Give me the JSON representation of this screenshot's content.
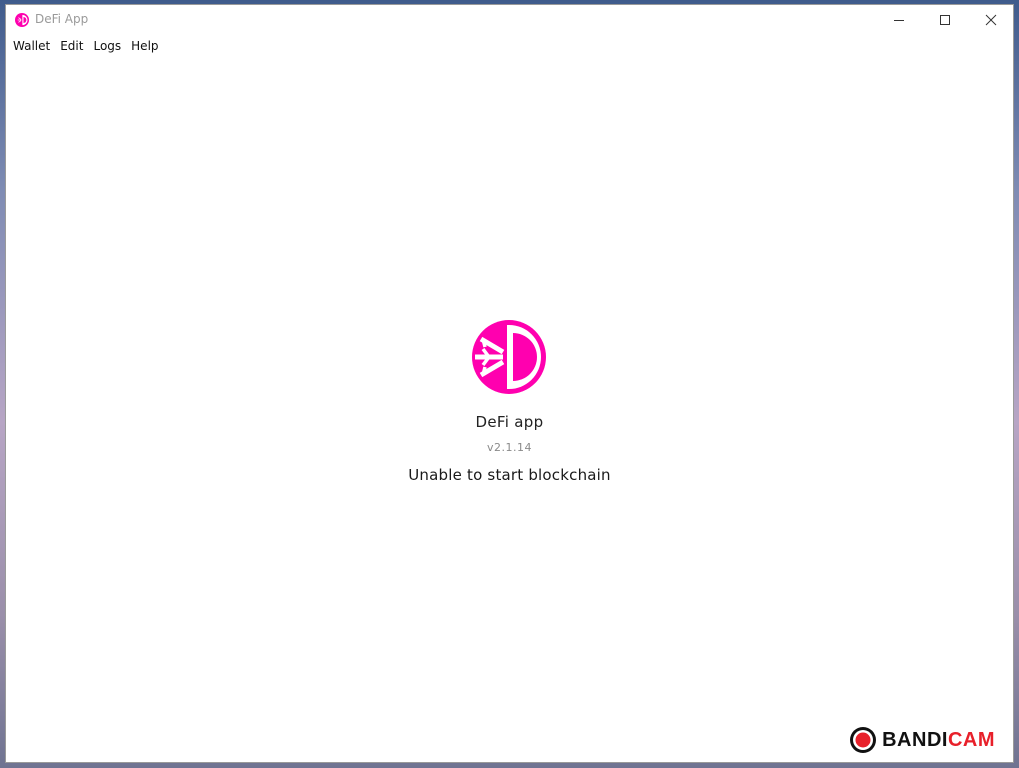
{
  "window": {
    "title": "DeFi App"
  },
  "menu": {
    "items": [
      {
        "label": "Wallet"
      },
      {
        "label": "Edit"
      },
      {
        "label": "Logs"
      },
      {
        "label": "Help"
      }
    ]
  },
  "main": {
    "app_name": "DeFi app",
    "version": "v2.1.14",
    "status": "Unable to start blockchain"
  },
  "watermark": {
    "text_part1": "BANDI",
    "text_part2": "CAM"
  },
  "colors": {
    "brand": "#ff00af",
    "watermark_red": "#e8202a"
  },
  "icons": {
    "app": "defi-logo-icon",
    "minimize": "minimize-icon",
    "maximize": "maximize-icon",
    "close": "close-icon",
    "record": "record-icon"
  }
}
